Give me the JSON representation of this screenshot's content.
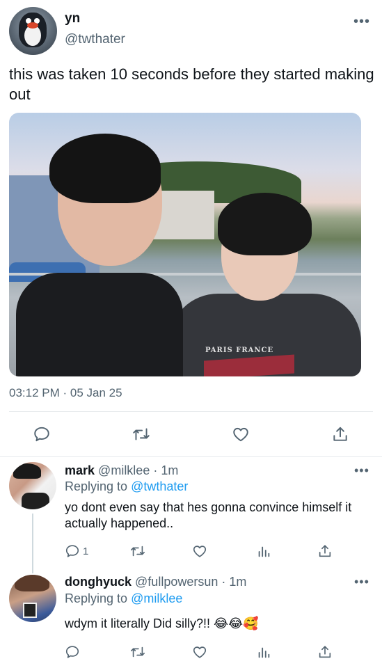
{
  "main_tweet": {
    "display_name": "yn",
    "handle": "@twthater",
    "text": "this was taken 10 seconds before they started making out",
    "photo_print": "PARIS FRANCE",
    "timestamp": "03:12 PM · 05 Jan 25",
    "more": "•••"
  },
  "replies": [
    {
      "display_name": "mark",
      "handle_time": "@milklee · 1m",
      "replying_prefix": "Replying to ",
      "replying_to": "@twthater",
      "text": "yo dont even say that hes gonna convince himself it actually happened..",
      "reply_count": "1",
      "more": "•••"
    },
    {
      "display_name": "donghyuck",
      "handle_time": "@fullpowersun · 1m",
      "replying_prefix": "Replying to ",
      "replying_to": "@milklee",
      "text": "wdym it literally Did silly?!! 😂😂🥰",
      "more": "•••"
    }
  ],
  "colors": {
    "text": "#0f1419",
    "secondary": "#536471",
    "link": "#1d9bf0",
    "divider": "#e6e9ec"
  },
  "icons": [
    "reply-icon",
    "retweet-icon",
    "like-icon",
    "share-icon",
    "analytics-icon"
  ]
}
